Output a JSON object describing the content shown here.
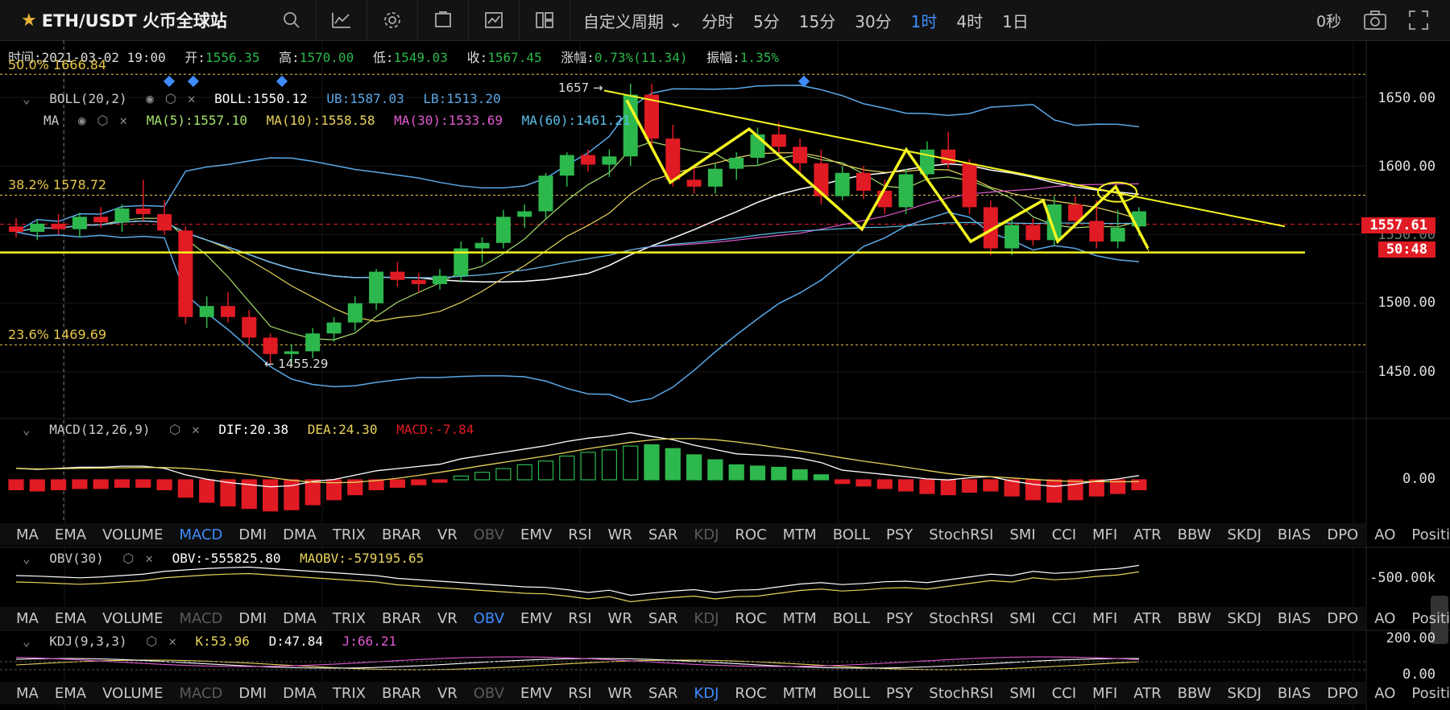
{
  "header": {
    "symbol": "ETH/USDT 火币全球站",
    "custom_period": "自定义周期 ⌄",
    "periods": [
      "分时",
      "5分",
      "15分",
      "30分",
      "1时",
      "4时",
      "1日"
    ],
    "active_period": "1时",
    "countdown": "0秒"
  },
  "infobar": {
    "time": "时间:2021-03-02 19:00",
    "open_label": "开:",
    "open": "1556.35",
    "high_label": "高:",
    "high": "1570.00",
    "low_label": "低:",
    "low": "1549.03",
    "close_label": "收:",
    "close": "1567.45",
    "change_label": "涨幅:",
    "change": "0.73%(11.34)",
    "amp_label": "振幅:",
    "amp": "1.35%"
  },
  "legend": {
    "boll_name": "BOLL(20,2)",
    "boll": "BOLL:1550.12",
    "ub": "UB:1587.03",
    "lb": "LB:1513.20",
    "ma_name": "MA",
    "ma5": "MA(5):1557.10",
    "ma10": "MA(10):1558.58",
    "ma30": "MA(30):1533.69",
    "ma60": "MA(60):1461.21",
    "macd_name": "MACD(12,26,9)",
    "dif": "DIF:20.38",
    "dea": "DEA:24.30",
    "macd": "MACD:-7.84",
    "obv_name": "OBV(30)",
    "obv": "OBV:-555825.80",
    "maobv": "MAOBV:-579195.65",
    "kdj_name": "KDJ(9,3,3)",
    "k": "K:53.96",
    "d": "D:47.84",
    "j": "J:66.21"
  },
  "fib": {
    "f50": "50.0% 1666.84",
    "f382": "38.2% 1578.72",
    "f236": "23.6% 1469.69"
  },
  "annotations": {
    "high": "1657 →",
    "low": "← 1455.29"
  },
  "price_tag": {
    "price": "1557.61",
    "timer": "50:48",
    "ghost": "1550.00"
  },
  "price_axis": [
    "1650.00",
    "1600.00",
    "1500.00",
    "1450.00"
  ],
  "macd_axis": [
    "0.00"
  ],
  "obv_axis": [
    "-500.00k"
  ],
  "kdj_axis": [
    "200.00",
    "0.00"
  ],
  "indicator_tabs": [
    "MA",
    "EMA",
    "VOLUME",
    "MACD",
    "DMI",
    "DMA",
    "TRIX",
    "BRAR",
    "VR",
    "OBV",
    "EMV",
    "RSI",
    "WR",
    "SAR",
    "KDJ",
    "ROC",
    "MTM",
    "BOLL",
    "PSY",
    "StochRSI",
    "SMI",
    "CCI",
    "MFI",
    "ATR",
    "BBW",
    "SKDJ",
    "BIAS",
    "DPO",
    "AO",
    "Position"
  ],
  "colors": {
    "up": "#2db84d",
    "down": "#e01b24",
    "boll": "#5aa8e8",
    "ma5": "#a6e06a",
    "ma10": "#e8d35a",
    "ma30": "#e05ad0",
    "ma60": "#5ac0e8",
    "fib": "#e8c84a",
    "trend": "#f5f520"
  },
  "chart_data": {
    "type": "candlestick",
    "ylim": [
      1400,
      1680
    ],
    "candles": [
      [
        1556,
        1562,
        1548,
        1552
      ],
      [
        1552,
        1561,
        1546,
        1558
      ],
      [
        1558,
        1565,
        1550,
        1554
      ],
      [
        1554,
        1566,
        1548,
        1563
      ],
      [
        1563,
        1570,
        1555,
        1559
      ],
      [
        1559,
        1572,
        1552,
        1569
      ],
      [
        1569,
        1590,
        1560,
        1565
      ],
      [
        1565,
        1575,
        1550,
        1553
      ],
      [
        1553,
        1556,
        1485,
        1490
      ],
      [
        1490,
        1505,
        1482,
        1498
      ],
      [
        1498,
        1508,
        1486,
        1490
      ],
      [
        1490,
        1495,
        1470,
        1475
      ],
      [
        1475,
        1478,
        1455,
        1463
      ],
      [
        1463,
        1470,
        1455,
        1465
      ],
      [
        1465,
        1482,
        1460,
        1478
      ],
      [
        1478,
        1490,
        1472,
        1486
      ],
      [
        1486,
        1505,
        1480,
        1500
      ],
      [
        1500,
        1525,
        1495,
        1523
      ],
      [
        1523,
        1530,
        1512,
        1517
      ],
      [
        1517,
        1522,
        1508,
        1514
      ],
      [
        1514,
        1525,
        1510,
        1520
      ],
      [
        1520,
        1545,
        1515,
        1540
      ],
      [
        1540,
        1548,
        1530,
        1544
      ],
      [
        1544,
        1568,
        1540,
        1563
      ],
      [
        1563,
        1572,
        1555,
        1567
      ],
      [
        1567,
        1595,
        1562,
        1593
      ],
      [
        1593,
        1610,
        1585,
        1608
      ],
      [
        1608,
        1612,
        1596,
        1601
      ],
      [
        1601,
        1612,
        1592,
        1607
      ],
      [
        1607,
        1660,
        1600,
        1652
      ],
      [
        1652,
        1660,
        1615,
        1620
      ],
      [
        1620,
        1630,
        1585,
        1590
      ],
      [
        1590,
        1600,
        1580,
        1585
      ],
      [
        1585,
        1602,
        1580,
        1598
      ],
      [
        1598,
        1610,
        1590,
        1606
      ],
      [
        1606,
        1628,
        1600,
        1623
      ],
      [
        1623,
        1632,
        1610,
        1614
      ],
      [
        1614,
        1620,
        1595,
        1602
      ],
      [
        1602,
        1612,
        1572,
        1578
      ],
      [
        1578,
        1600,
        1575,
        1595
      ],
      [
        1595,
        1600,
        1576,
        1582
      ],
      [
        1582,
        1590,
        1565,
        1570
      ],
      [
        1570,
        1598,
        1565,
        1594
      ],
      [
        1594,
        1618,
        1590,
        1612
      ],
      [
        1612,
        1625,
        1598,
        1602
      ],
      [
        1602,
        1605,
        1565,
        1570
      ],
      [
        1570,
        1575,
        1535,
        1540
      ],
      [
        1540,
        1562,
        1535,
        1557
      ],
      [
        1557,
        1562,
        1542,
        1546
      ],
      [
        1546,
        1578,
        1542,
        1572
      ],
      [
        1572,
        1578,
        1558,
        1560
      ],
      [
        1560,
        1575,
        1540,
        1545
      ],
      [
        1545,
        1568,
        1540,
        1555
      ],
      [
        1556,
        1570,
        1549,
        1567
      ]
    ],
    "macd_hist": [
      -8,
      -9,
      -8,
      -7,
      -7,
      -6,
      -6,
      -8,
      -14,
      -18,
      -21,
      -23,
      -25,
      -24,
      -20,
      -16,
      -12,
      -8,
      -6,
      -4,
      -2,
      3,
      6,
      9,
      12,
      15,
      19,
      22,
      24,
      27,
      28,
      25,
      20,
      16,
      12,
      11,
      10,
      8,
      4,
      -3,
      -5,
      -7,
      -9,
      -11,
      -12,
      -10,
      -9,
      -13,
      -16,
      -18,
      -16,
      -13,
      -11,
      -8
    ],
    "obv": [
      -520,
      -518,
      -515,
      -512,
      -515,
      -520,
      -525,
      -535,
      -540,
      -545,
      -548,
      -550,
      -545,
      -540,
      -535,
      -530,
      -525,
      -520,
      -510,
      -505,
      -500,
      -495,
      -490,
      -485,
      -480,
      -478,
      -470,
      -460,
      -468,
      -450,
      -458,
      -465,
      -470,
      -460,
      -468,
      -470,
      -480,
      -490,
      -495,
      -488,
      -492,
      -498,
      -500,
      -495,
      -505,
      -515,
      -525,
      -520,
      -535,
      -528,
      -532,
      -540,
      -545,
      -556
    ]
  }
}
